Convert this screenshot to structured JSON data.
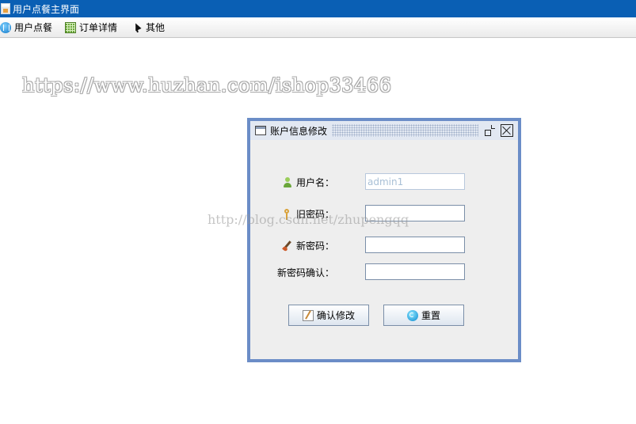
{
  "window": {
    "title": "用户点餐主界面"
  },
  "menubar": {
    "items": [
      {
        "label": "用户点餐",
        "icon": "order-icon"
      },
      {
        "label": "订单详情",
        "icon": "calculator-icon"
      },
      {
        "label": "其他",
        "icon": "cursor-icon"
      }
    ]
  },
  "watermarks": {
    "primary": "https://www.huzhan.com/ishop33466",
    "secondary": "http://blog.csdn.net/zhupengqq"
  },
  "dialog": {
    "title": "账户信息修改",
    "fields": {
      "username": {
        "label": "用户名：",
        "value": "admin1"
      },
      "old_password": {
        "label": "旧密码：",
        "value": ""
      },
      "new_password": {
        "label": "新密码：",
        "value": ""
      },
      "confirm_password": {
        "label": "新密码确认：",
        "value": ""
      }
    },
    "buttons": {
      "confirm": "确认修改",
      "reset": "重置"
    }
  },
  "colors": {
    "titlebar": "#0a5fb4",
    "frame_border": "#6b8dc7",
    "dialog_background": "#eeeeee"
  }
}
